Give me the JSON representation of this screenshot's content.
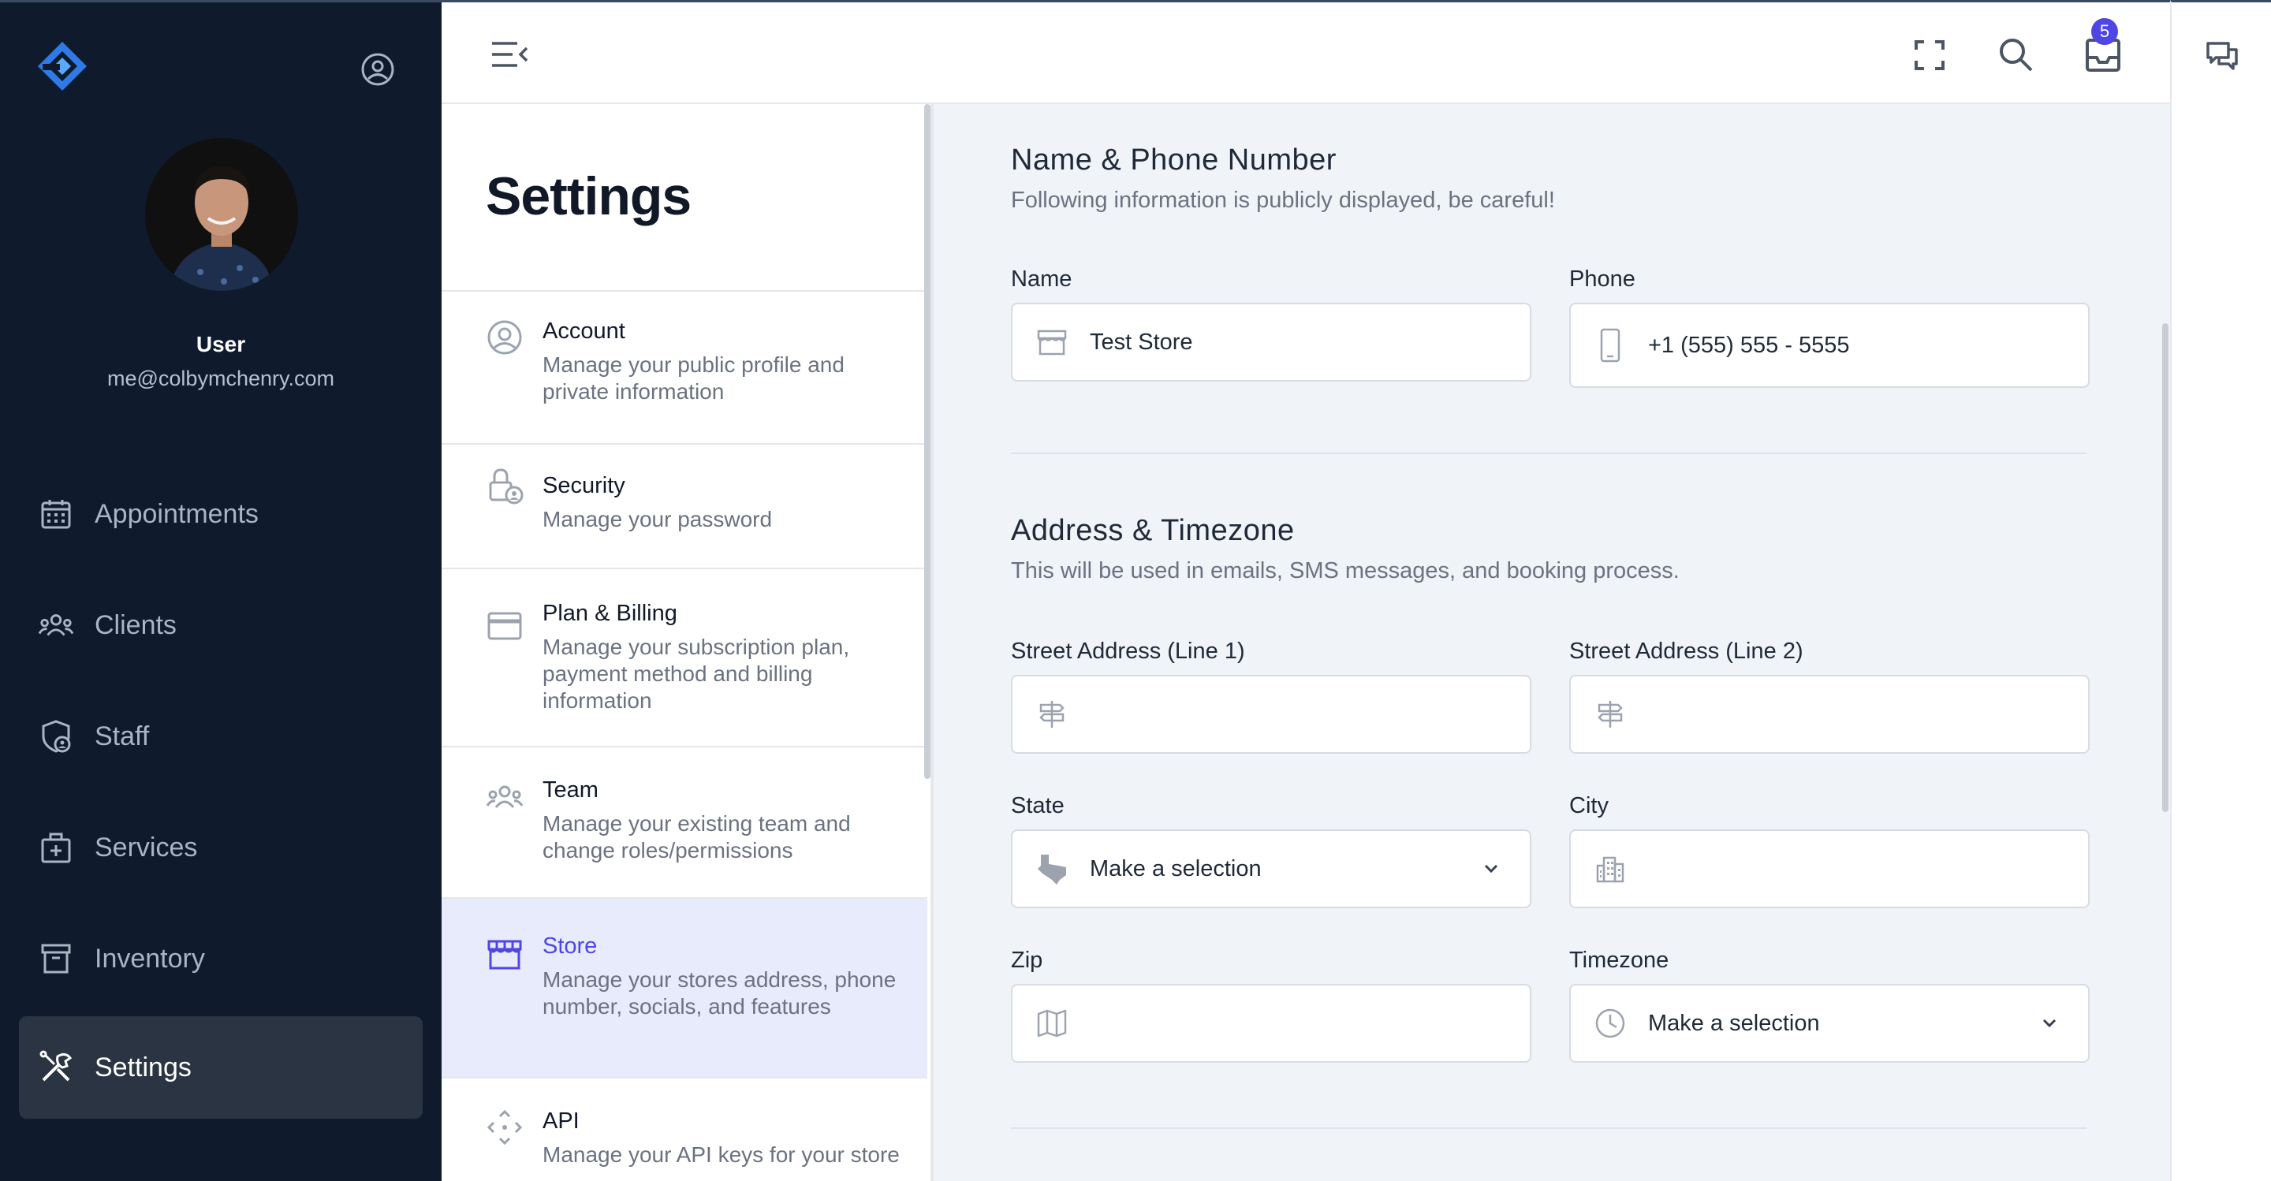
{
  "sidebar": {
    "user_name": "User",
    "user_email": "me@colbymchenry.com",
    "nav": [
      {
        "label": "Appointments",
        "icon": "calendar-icon"
      },
      {
        "label": "Clients",
        "icon": "users-icon"
      },
      {
        "label": "Staff",
        "icon": "shield-user-icon"
      },
      {
        "label": "Services",
        "icon": "briefcase-plus-icon"
      },
      {
        "label": "Inventory",
        "icon": "archive-icon"
      },
      {
        "label": "Settings",
        "icon": "tools-icon",
        "active": true
      }
    ]
  },
  "topbar": {
    "notification_count": "5"
  },
  "settings_menu": {
    "title": "Settings",
    "items": [
      {
        "title": "Account",
        "description": "Manage your public profile and private information",
        "icon": "user-circle-icon"
      },
      {
        "title": "Security",
        "description": "Manage your password",
        "icon": "lock-user-icon"
      },
      {
        "title": "Plan & Billing",
        "description": "Manage your subscription plan, payment method and billing information",
        "icon": "credit-card-icon"
      },
      {
        "title": "Team",
        "description": "Manage your existing team and change roles/permissions",
        "icon": "team-icon"
      },
      {
        "title": "Store",
        "description": "Manage your stores address, phone number, socials, and features",
        "icon": "store-icon",
        "active": true
      },
      {
        "title": "API",
        "description": "Manage your API keys for your store",
        "icon": "api-icon"
      }
    ]
  },
  "form": {
    "name_section": {
      "title": "Name & Phone Number",
      "subtitle": "Following information is publicly displayed, be careful!",
      "name_label": "Name",
      "name_value": "Test Store",
      "phone_label": "Phone",
      "phone_value": "+1 (555) 555 - 5555"
    },
    "address_section": {
      "title": "Address & Timezone",
      "subtitle": "This will be used in emails, SMS messages, and booking process.",
      "street1_label": "Street Address (Line 1)",
      "street2_label": "Street Address (Line 2)",
      "state_label": "State",
      "state_value": "Make a selection",
      "city_label": "City",
      "zip_label": "Zip",
      "timezone_label": "Timezone",
      "timezone_value": "Make a selection"
    }
  },
  "colors": {
    "sidebar_bg": "#0f1b2d",
    "accent": "#4f46e5",
    "logo": "#3b8ef0"
  }
}
